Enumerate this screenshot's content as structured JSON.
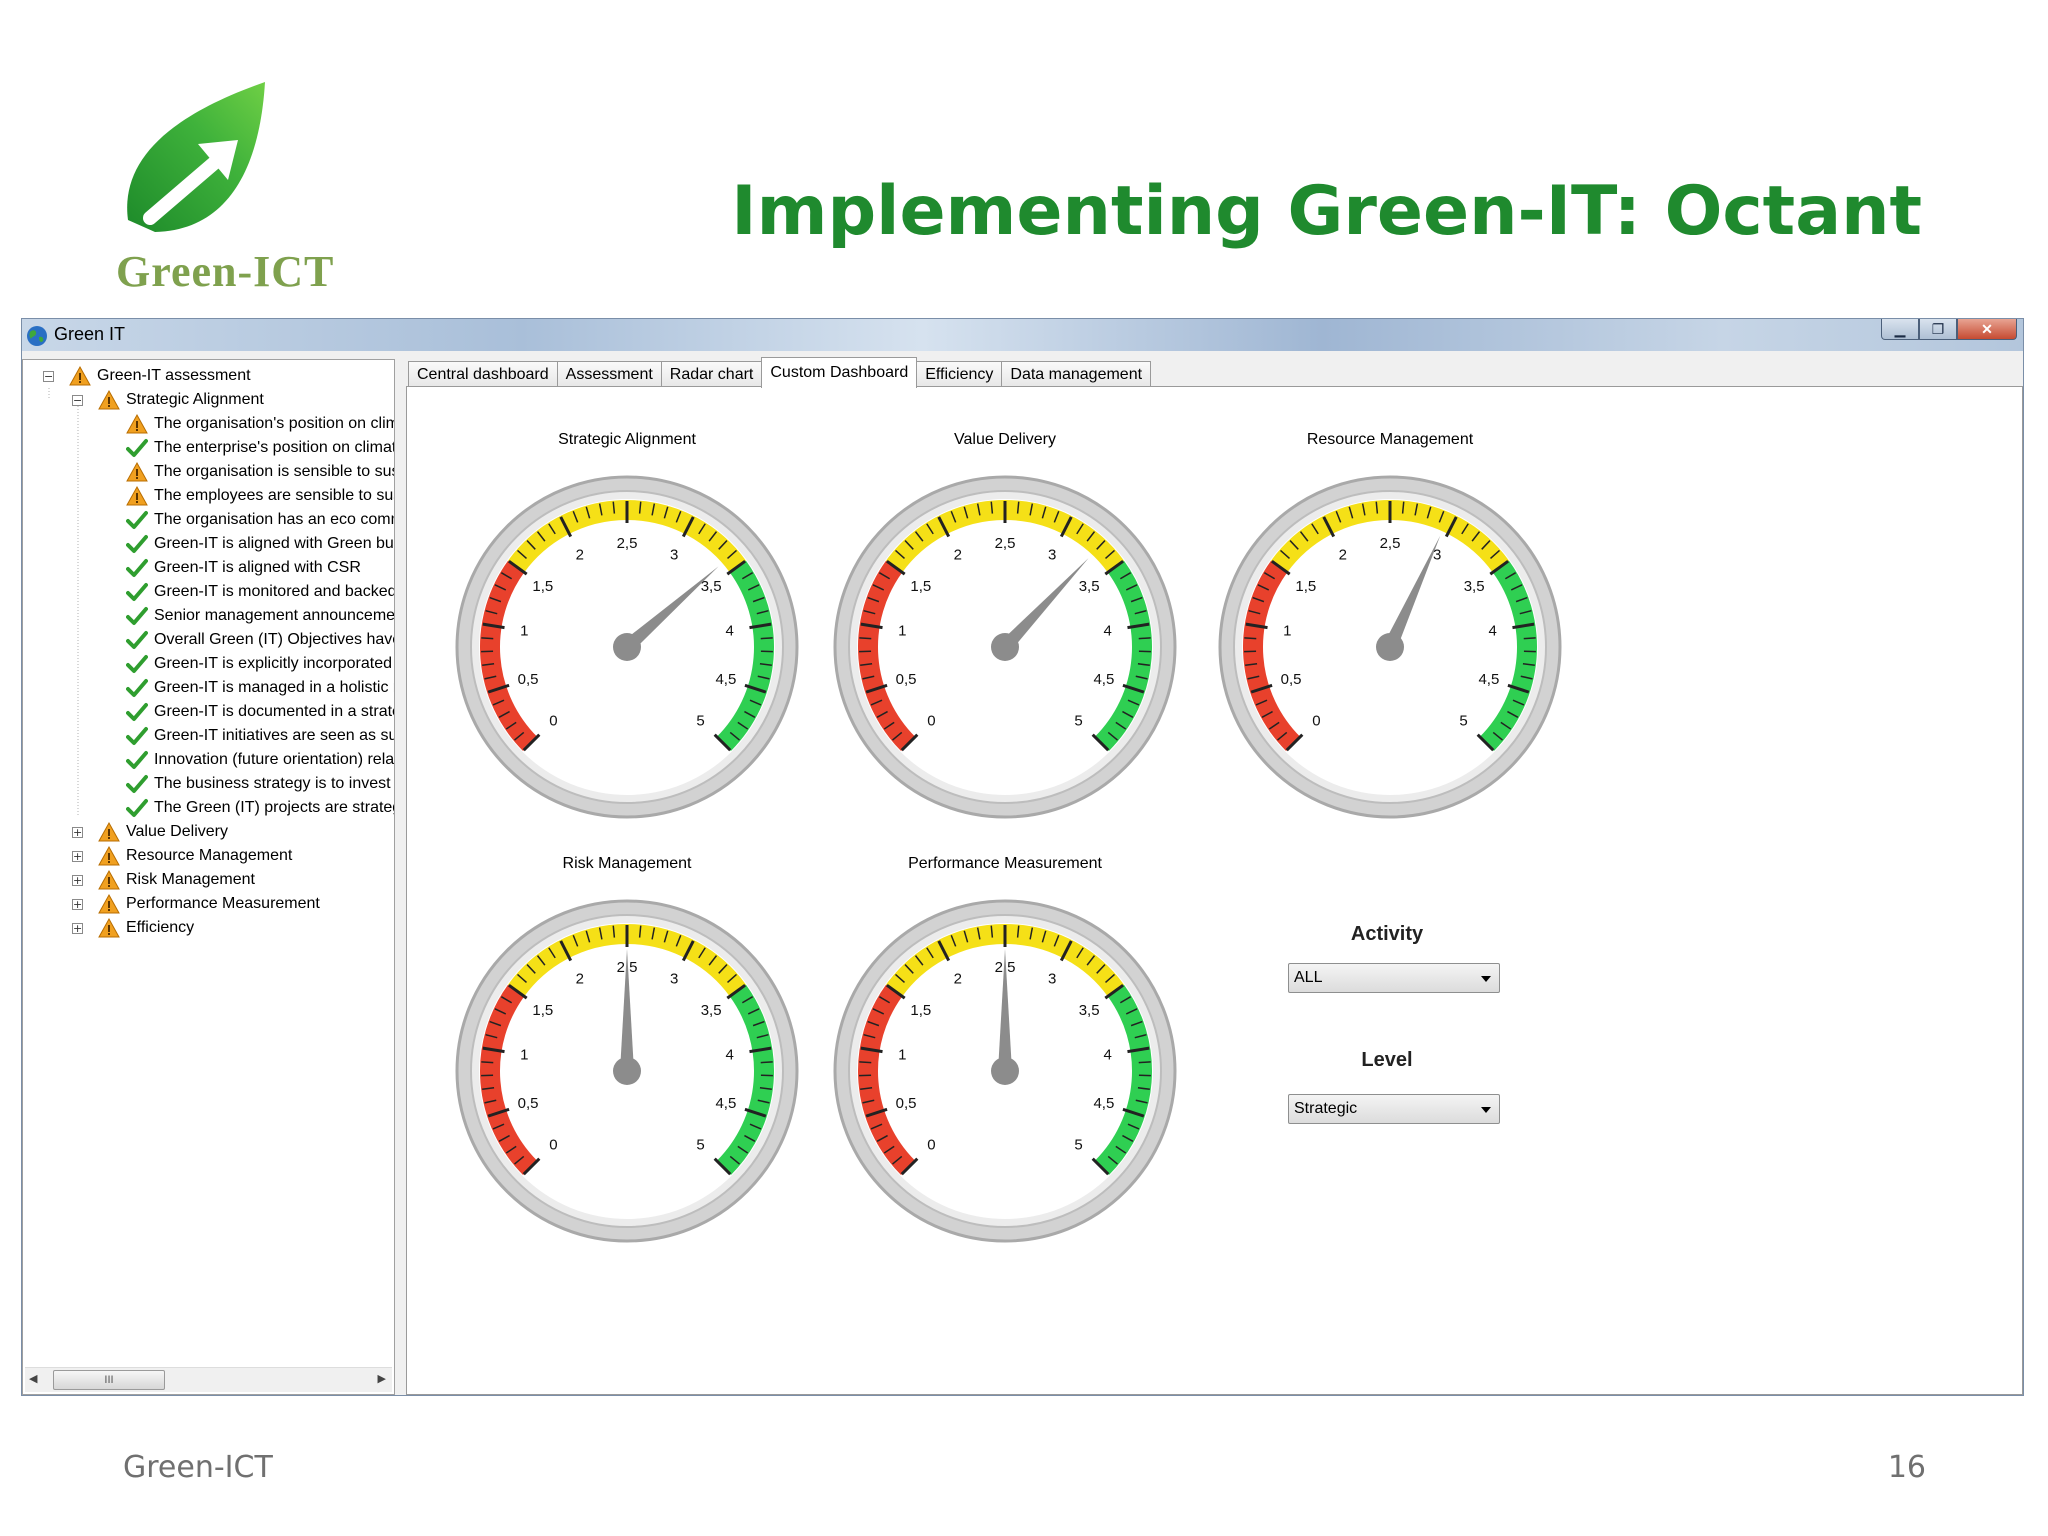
{
  "slide": {
    "title": "Implementing Green-IT: Octant",
    "logo_text": "Green-ICT",
    "footer_left": "Green-ICT",
    "page_number": "16",
    "brand_color": "#1f8a2e"
  },
  "window": {
    "title": "Green IT",
    "controls": [
      "minimize-icon",
      "restore-icon",
      "close-icon"
    ]
  },
  "tree": {
    "root": "Green-IT assessment",
    "expanded_group": "Strategic Alignment",
    "children": [
      {
        "label": "The organisation's position on climat",
        "status": "warning"
      },
      {
        "label": "The enterprise's position on climate c",
        "status": "ok"
      },
      {
        "label": "The organisation is sensible to susta",
        "status": "warning"
      },
      {
        "label": "The employees are sensible to susta",
        "status": "warning"
      },
      {
        "label": "The organisation has an eco commit",
        "status": "ok"
      },
      {
        "label": "Green-IT is aligned with Green busin",
        "status": "ok"
      },
      {
        "label": "Green-IT is aligned with CSR",
        "status": "ok"
      },
      {
        "label": "Green-IT is monitored and backed b",
        "status": "ok"
      },
      {
        "label": "Senior management announcements",
        "status": "ok"
      },
      {
        "label": "Overall Green (IT) Objectives have b",
        "status": "ok"
      },
      {
        "label": "Green-IT is explicitly incorporated in",
        "status": "ok"
      },
      {
        "label": "Green-IT is managed in a holistic ma",
        "status": "ok"
      },
      {
        "label": "Green-IT is documented in a strategi",
        "status": "ok"
      },
      {
        "label": "Green-IT initiatives are seen as susta",
        "status": "ok"
      },
      {
        "label": "Innovation (future orientation) relatec",
        "status": "ok"
      },
      {
        "label": "The business strategy is to invest in",
        "status": "ok"
      },
      {
        "label": "The Green (IT) projects are strategic",
        "status": "ok"
      }
    ],
    "collapsed_groups": [
      "Value Delivery",
      "Resource Management",
      "Risk Management",
      "Performance Measurement",
      "Efficiency"
    ],
    "scroll_thumb": "III"
  },
  "tabs": [
    "Central dashboard",
    "Assessment",
    "Radar chart",
    "Custom Dashboard",
    "Efficiency",
    "Data management"
  ],
  "active_tab": 3,
  "gauge_ticks": [
    "0",
    "0,5",
    "1",
    "1,5",
    "2",
    "2,5",
    "3",
    "3,5",
    "4",
    "4,5",
    "5"
  ],
  "gauges": [
    {
      "title": "Strategic Alignment",
      "value": 3.4
    },
    {
      "title": "Value Delivery",
      "value": 3.3
    },
    {
      "title": "Resource Management",
      "value": 2.95
    },
    {
      "title": "Risk Management",
      "value": 2.5
    },
    {
      "title": "Performance Measurement",
      "value": 2.5
    }
  ],
  "filters": {
    "activity_label": "Activity",
    "activity_value": "ALL",
    "level_label": "Level",
    "level_value": "Strategic"
  },
  "colors": {
    "zone_red": "#e8412c",
    "zone_yellow": "#f5e017",
    "zone_green": "#2fcf52",
    "needle": "#8c8c8c",
    "warning": "#f0a020",
    "ok": "#2f9e2f"
  }
}
